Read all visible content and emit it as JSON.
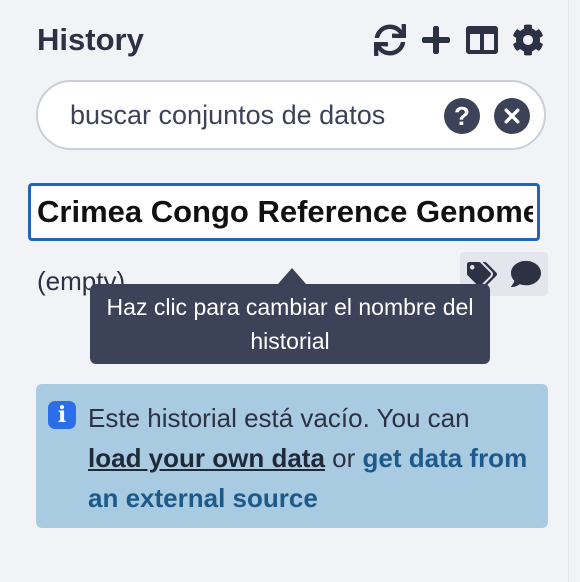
{
  "panel": {
    "title": "History",
    "toolbar": [
      {
        "icon": "sync-icon"
      },
      {
        "icon": "plus-icon"
      },
      {
        "icon": "columns-icon"
      },
      {
        "icon": "gear-icon"
      }
    ]
  },
  "search": {
    "placeholder": "buscar conjuntos de datos",
    "help_label": "?",
    "clear_icon": "times-circle-icon"
  },
  "history_name": {
    "value": "Crimea Congo Reference Genome"
  },
  "status": {
    "empty_label": "(empty)"
  },
  "tooltip": {
    "text": "Haz clic para cambiar el nombre del historial"
  },
  "alert": {
    "info_glyph": "i",
    "text_before": "Este historial está vacío. You can ",
    "link_load": "load your own data",
    "text_middle": " or ",
    "link_get": "get data from an external source"
  },
  "colors": {
    "accent_border": "#2265b8",
    "alert_bg": "#a9cbe2",
    "tooltip_bg": "#3c4257",
    "info_icon": "#2b6ee8"
  }
}
